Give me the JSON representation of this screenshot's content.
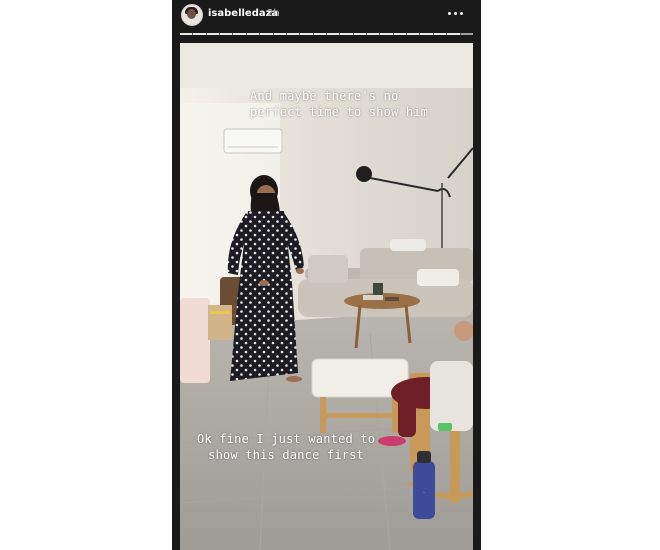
{
  "story": {
    "username": "isabelledaza",
    "time_ago": "2h",
    "menu_icon": "more-horizontal-icon",
    "progress": {
      "segments": 22,
      "completed": 21
    },
    "captions": {
      "top_line1": "And maybe there's no",
      "top_line2": "perfect time to show him",
      "bottom_line1": "Ok fine I just wanted to",
      "bottom_line2": "show this dance first"
    }
  }
}
